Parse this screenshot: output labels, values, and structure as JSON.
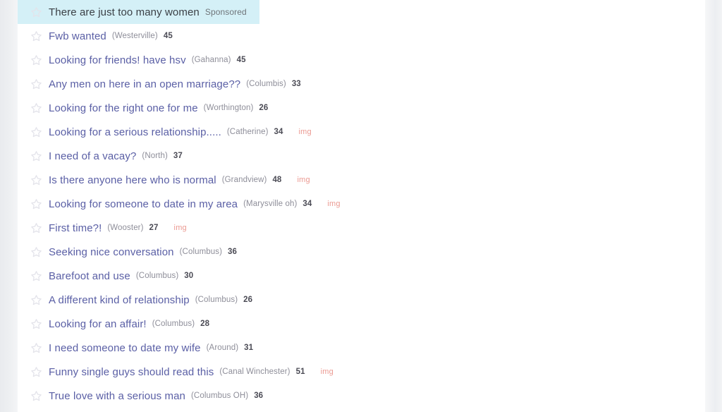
{
  "page": {
    "background_color": "#eceef1",
    "content_background": "#ffffff",
    "sponsored_highlight_color": "#d4f0f7",
    "title_link_color": "#5a5fa5",
    "img_badge_color": "#eb9a92"
  },
  "icons": {
    "star": "star-outline-icon"
  },
  "labels": {
    "sponsored": "Sponsored",
    "img_badge": "img"
  },
  "threads": [
    {
      "title": "There are just too many women",
      "location": "",
      "count": "",
      "has_img": false,
      "sponsored": true
    },
    {
      "title": "Fwb wanted",
      "location": "(Westerville)",
      "count": "45",
      "has_img": false,
      "sponsored": false
    },
    {
      "title": "Looking for friends! have hsv",
      "location": "(Gahanna)",
      "count": "45",
      "has_img": false,
      "sponsored": false
    },
    {
      "title": "Any men on here in an open marriage??",
      "location": "(Columbis)",
      "count": "33",
      "has_img": false,
      "sponsored": false
    },
    {
      "title": "Looking for the right one for me",
      "location": "(Worthington)",
      "count": "26",
      "has_img": false,
      "sponsored": false
    },
    {
      "title": "Looking for a serious relationship.....",
      "location": "(Catherine)",
      "count": "34",
      "has_img": true,
      "sponsored": false
    },
    {
      "title": "I need of a vacay?",
      "location": "(North)",
      "count": "37",
      "has_img": false,
      "sponsored": false
    },
    {
      "title": "Is there anyone here who is normal",
      "location": "(Grandview)",
      "count": "48",
      "has_img": true,
      "sponsored": false
    },
    {
      "title": "Looking for someone to date in my area",
      "location": "(Marysville oh)",
      "count": "34",
      "has_img": true,
      "sponsored": false
    },
    {
      "title": "First time?!",
      "location": "(Wooster)",
      "count": "27",
      "has_img": true,
      "sponsored": false
    },
    {
      "title": "Seeking nice conversation",
      "location": "(Columbus)",
      "count": "36",
      "has_img": false,
      "sponsored": false
    },
    {
      "title": "Barefoot and use",
      "location": "(Columbus)",
      "count": "30",
      "has_img": false,
      "sponsored": false
    },
    {
      "title": "A different kind of relationship",
      "location": "(Columbus)",
      "count": "26",
      "has_img": false,
      "sponsored": false
    },
    {
      "title": "Looking for an affair!",
      "location": "(Columbus)",
      "count": "28",
      "has_img": false,
      "sponsored": false
    },
    {
      "title": "I need someone to date my wife",
      "location": "(Around)",
      "count": "31",
      "has_img": false,
      "sponsored": false
    },
    {
      "title": "Funny single guys should read this",
      "location": "(Canal Winchester)",
      "count": "51",
      "has_img": true,
      "sponsored": false
    },
    {
      "title": "True love with a serious man",
      "location": "(Columbus OH)",
      "count": "36",
      "has_img": false,
      "sponsored": false
    }
  ]
}
